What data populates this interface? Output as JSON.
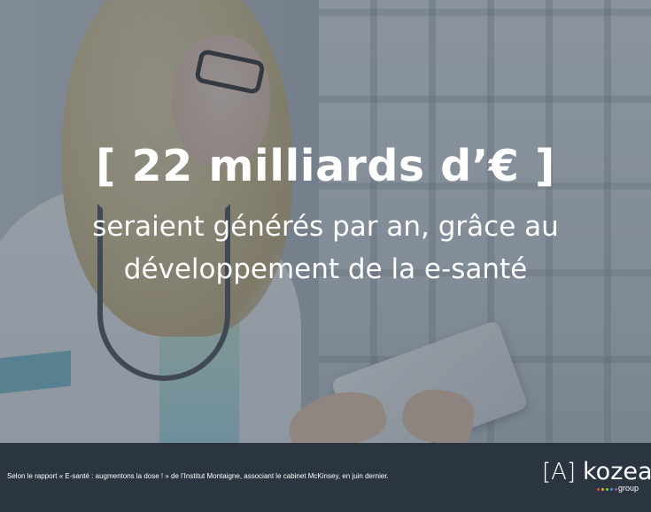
{
  "headline": "[ 22 milliards d’€ ]",
  "subline": {
    "line1": "seraient générés par an, grâce au",
    "line2": "développement de la e-santé"
  },
  "footer": {
    "source": "Selon le rapport « E-santé : augmentons la dose ! » de l’Institut Montaigne, associant le cabinet McKinsey, en juin dernier.",
    "logo": {
      "bracket": "[A]",
      "word": "kozea",
      "suffix": "group"
    }
  },
  "colors": {
    "footer_bg": "#2b3540",
    "overlay": "rgba(70,82,96,0.55)",
    "text": "#ffffff",
    "logo_dots": [
      "#e94e3c",
      "#f5a623",
      "#7ed321",
      "#4a90e2",
      "#9b59b6"
    ]
  }
}
